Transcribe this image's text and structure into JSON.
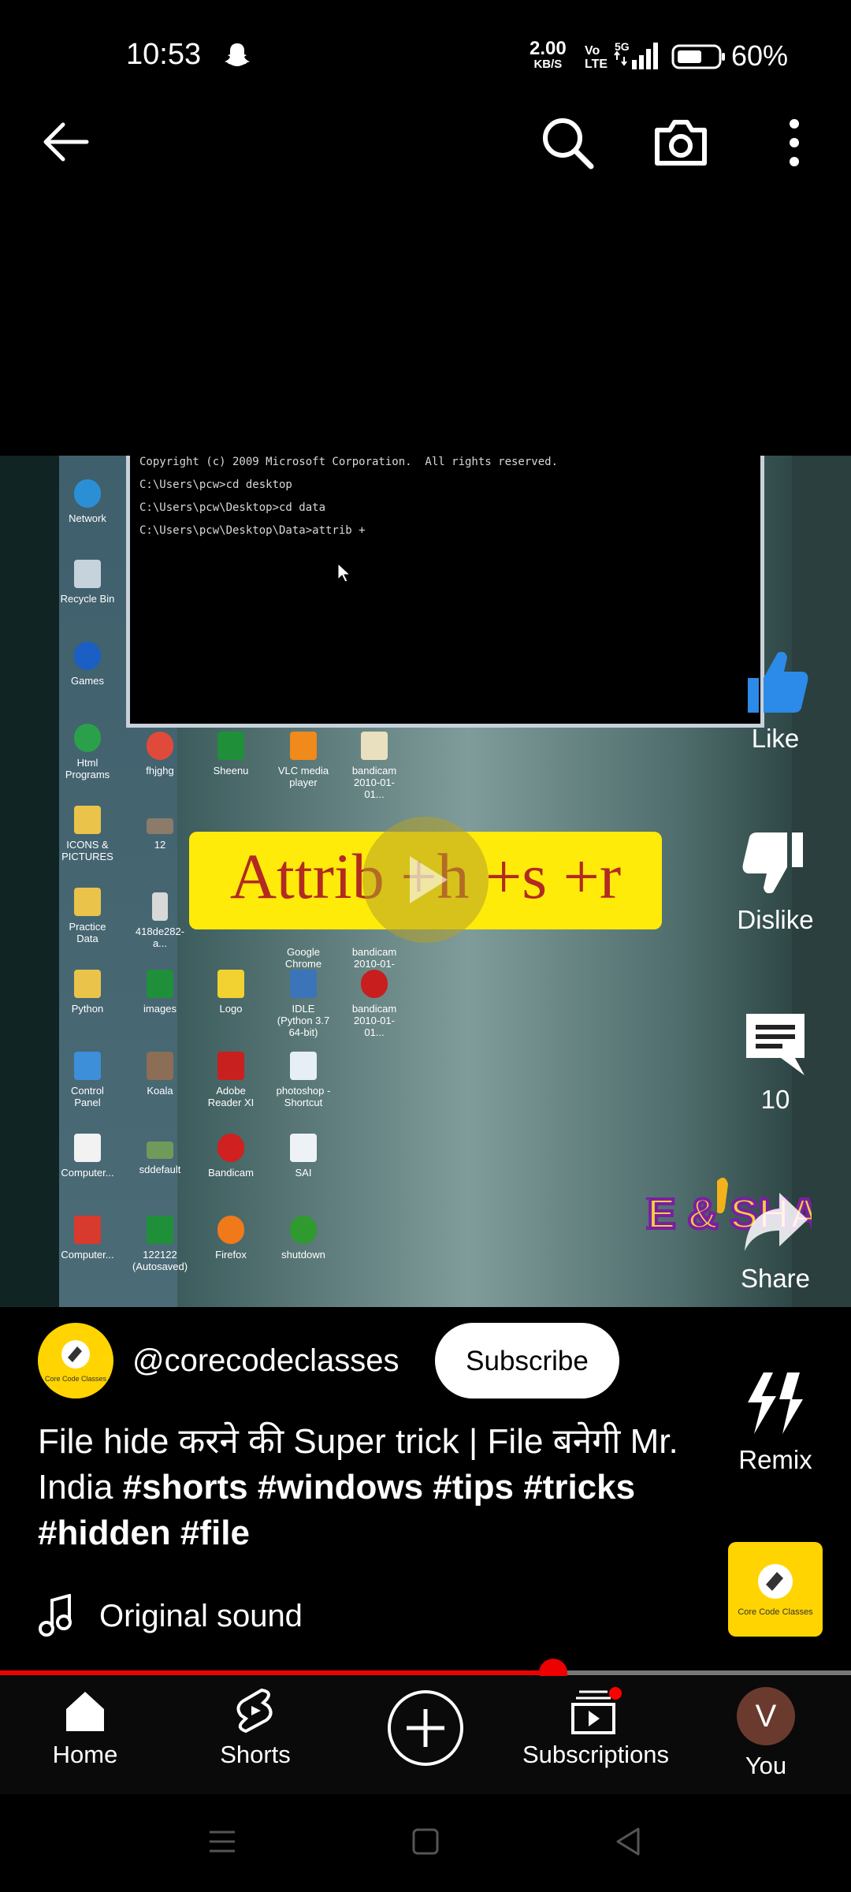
{
  "status_bar": {
    "time": "10:53",
    "net_speed_value": "2.00",
    "net_speed_unit": "KB/S",
    "volte_top": "Vo",
    "volte_bottom": "LTE",
    "network": "5G",
    "battery": "60%"
  },
  "top_bar": {
    "icons": [
      "back-arrow-icon",
      "search-icon",
      "camera-icon",
      "more-vert-icon"
    ]
  },
  "video": {
    "cmd_lines": [
      "Copyright (c) 2009 Microsoft Corporation.  All rights reserved.",
      "C:\\Users\\pcw>cd desktop",
      "C:\\Users\\pcw\\Desktop>cd data",
      "C:\\Users\\pcw\\Desktop\\Data>attrib +"
    ],
    "caption": "Attrib +h +s +r",
    "desktop_icons": [
      "Network",
      "Recycle Bin",
      "Games",
      "Html Programs",
      "ICONS & PICTURES",
      "Practice Data",
      "Python",
      "Control Panel",
      "Computer...",
      "Computer...",
      "fhjghg",
      "12",
      "418de282-a...",
      "images",
      "Koala",
      "sddefault",
      "122122 (Autosaved)",
      "Sheenu",
      "Logo",
      "Adobe Reader XI",
      "Bandicam",
      "Firefox",
      "VLC media player",
      "Google Chrome",
      "IDLE (Python 3.7 64-bit)",
      "photoshop - Shortcut",
      "SAI",
      "shutdown",
      "bandicam 2010-01-01...",
      "bandicam 2010-01-01...",
      "bandicam 2010-01-01..."
    ],
    "sticker_text": "LIKE & SHARE"
  },
  "actions": {
    "like": "Like",
    "dislike": "Dislike",
    "comments": "10",
    "share": "Share",
    "remix": "Remix"
  },
  "channel": {
    "handle": "@corecodeclasses",
    "subscribe": "Subscribe",
    "avatar_text": "Core Code Classes"
  },
  "title": {
    "text": "File hide करने की Super trick | File बनेगी Mr.  India ",
    "hashtags": "#shorts #windows #tips #tricks #hidden #file"
  },
  "sound": {
    "label": "Original sound"
  },
  "progress": 0.65,
  "bottom_nav": {
    "home": "Home",
    "shorts": "Shorts",
    "subscriptions": "Subscriptions",
    "you": "You",
    "you_initial": "V"
  },
  "colors": {
    "accent": "#ff0000",
    "channel_yellow": "#ffd400",
    "caption_yellow": "#ffeb0a",
    "caption_red": "#b22a22"
  }
}
